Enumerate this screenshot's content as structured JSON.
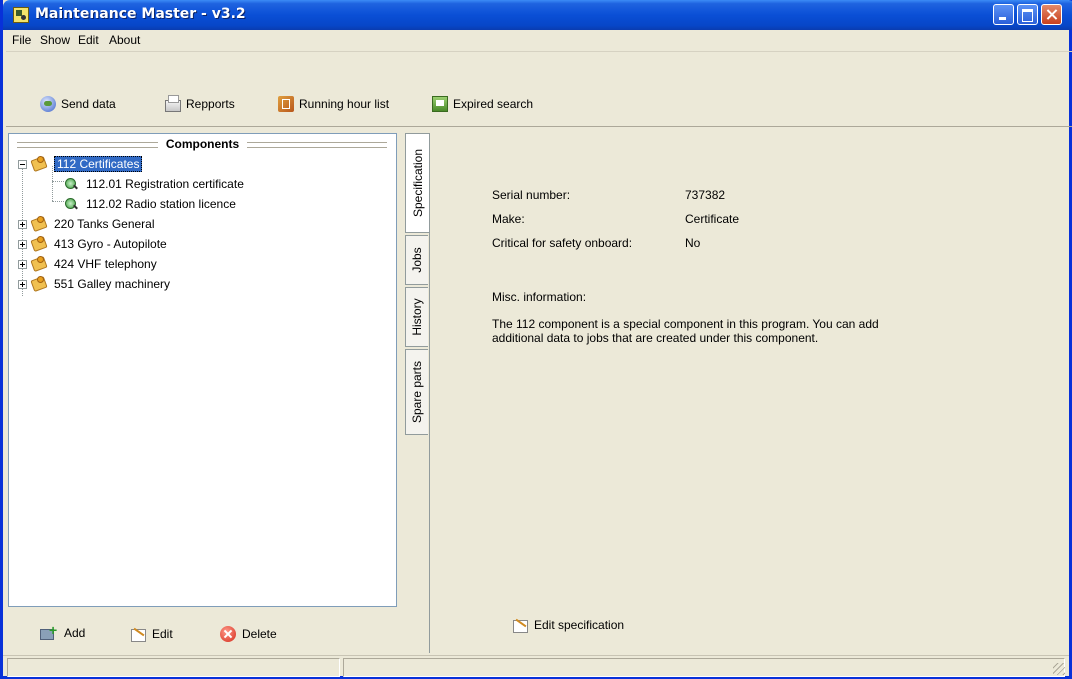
{
  "window": {
    "title": "Maintenance Master - v3.2"
  },
  "menu": [
    "File",
    "Show",
    "Edit",
    "About"
  ],
  "toolbar": {
    "send_data": "Send data",
    "repports": "Repports",
    "running_hour_list": "Running hour list",
    "expired_search": "Expired search"
  },
  "components_panel": {
    "title": "Components",
    "tree": [
      {
        "label": "112  Certificates",
        "expanded": true,
        "selected": true,
        "children": [
          {
            "label": "112.01  Registration certificate"
          },
          {
            "label": "112.02  Radio station licence"
          }
        ]
      },
      {
        "label": "220  Tanks General",
        "expanded": false
      },
      {
        "label": "413  Gyro - Autopilote",
        "expanded": false
      },
      {
        "label": "424  VHF telephony",
        "expanded": false
      },
      {
        "label": "551  Galley machinery",
        "expanded": false
      }
    ],
    "buttons": {
      "add": "Add",
      "edit": "Edit",
      "delete": "Delete"
    }
  },
  "tabs": [
    "Specification",
    "Jobs",
    "History",
    "Spare parts"
  ],
  "specification": {
    "serial_label": "Serial number:",
    "serial_value": "737382",
    "make_label": "Make:",
    "make_value": "Certificate",
    "critical_label": "Critical for safety onboard:",
    "critical_value": "No",
    "misc_label": "Misc. information:",
    "misc_text": "The 112 component is a special component in this program. You can add additional data to jobs that are created under this component.",
    "edit_button": "Edit specification"
  }
}
